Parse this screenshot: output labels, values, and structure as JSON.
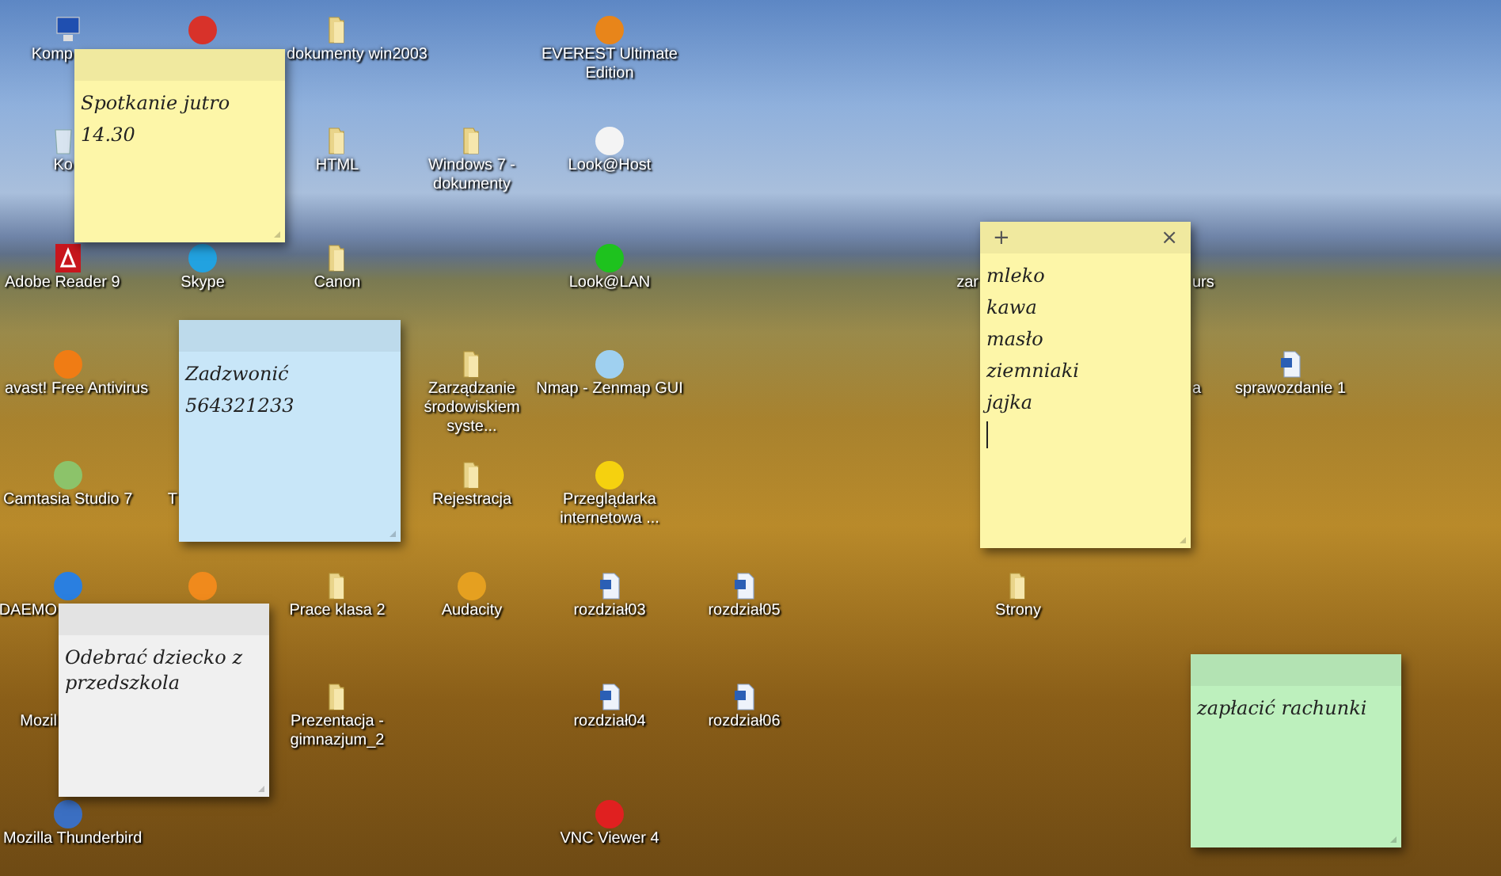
{
  "desktop": {
    "icons": [
      {
        "kind": "computer",
        "label": "Komp"
      },
      {
        "kind": "app",
        "color": "#d8322a"
      },
      {
        "kind": "folder",
        "label": "dokumenty win2003"
      },
      {
        "kind": "app",
        "color": "#e8851a",
        "label": "EVEREST Ultimate Edition"
      },
      {
        "kind": "recycle",
        "label": "Ko"
      },
      {
        "kind": "folder",
        "label": "HTML"
      },
      {
        "kind": "folder",
        "label": "Windows 7 - dokumenty"
      },
      {
        "kind": "app",
        "color": "#f4f4f4",
        "label": "Look@Host"
      },
      {
        "kind": "pdf",
        "label": "Adobe Reader 9"
      },
      {
        "kind": "app",
        "color": "#22a2e0",
        "label": "Skype"
      },
      {
        "kind": "folder",
        "label": "Canon"
      },
      {
        "kind": "app",
        "color": "#1ec21e",
        "label": "Look@LAN"
      },
      {
        "kind": "hidden",
        "label": "zar"
      },
      {
        "kind": "hidden",
        "label": "urs"
      },
      {
        "kind": "app",
        "color": "#f07c14",
        "label": "avast! Free Antivirus"
      },
      {
        "kind": "folder",
        "label": "Zarządzanie środowiskiem syste..."
      },
      {
        "kind": "app",
        "color": "#9fd0f0",
        "label": "Nmap - Zenmap GUI"
      },
      {
        "kind": "hidden",
        "label": "a"
      },
      {
        "kind": "document",
        "label": "sprawozdanie 1"
      },
      {
        "kind": "app",
        "color": "#8cc36a",
        "label": "Camtasia Studio 7"
      },
      {
        "kind": "hidden",
        "label": "T"
      },
      {
        "kind": "folder",
        "label": "Rejestracja"
      },
      {
        "kind": "app",
        "color": "#f5d10f",
        "label": "Przeglądarka internetowa ..."
      },
      {
        "kind": "app",
        "color": "#2a7fe0",
        "label": "DAEMO"
      },
      {
        "kind": "app",
        "color": "#f08a1c"
      },
      {
        "kind": "folder",
        "label": "Prace klasa 2"
      },
      {
        "kind": "app",
        "color": "#e5a020",
        "label": "Audacity"
      },
      {
        "kind": "document",
        "label": "rozdział03"
      },
      {
        "kind": "document",
        "label": "rozdział05"
      },
      {
        "kind": "folder",
        "label": "Strony"
      },
      {
        "kind": "hidden",
        "label": "Mozil"
      },
      {
        "kind": "folder",
        "label": "Prezentacja - gimnazjum_2"
      },
      {
        "kind": "document",
        "label": "rozdział04"
      },
      {
        "kind": "document",
        "label": "rozdział06"
      },
      {
        "kind": "app",
        "color": "#3b6fc2",
        "label": "Mozilla Thunderbird"
      },
      {
        "kind": "app",
        "color": "#e02020",
        "label": "VNC Viewer 4"
      }
    ]
  },
  "notes": [
    {
      "color": "#fdf6a8",
      "active": false,
      "lines": [
        "Spotkanie jutro",
        "14.30"
      ]
    },
    {
      "color": "#c8e6f8",
      "active": false,
      "lines": [
        "Zadzwonić",
        "564321233"
      ]
    },
    {
      "color": "#fdf6a8",
      "active": true,
      "buttons": [
        "+",
        "×"
      ],
      "lines": [
        "mleko",
        "kawa",
        "masło",
        "ziemniaki",
        "jajka"
      ]
    },
    {
      "color": "#f0f0f0",
      "active": false,
      "lines": [
        "Odebrać dziecko z przedszkola"
      ]
    },
    {
      "color": "#bdf0bd",
      "active": false,
      "lines": [
        "zapłacić rachunki"
      ]
    }
  ]
}
